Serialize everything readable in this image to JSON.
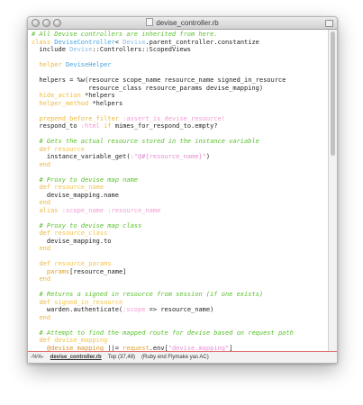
{
  "window": {
    "title": "devise_controller.rb"
  },
  "editor": {
    "lines": [
      [
        [
          "c",
          "# All Devise controllers are inherited from here."
        ]
      ],
      [
        [
          "k",
          "class "
        ],
        [
          "cl",
          "DeviseController"
        ],
        [
          "",
          "< "
        ],
        [
          "ce",
          "Devise"
        ],
        [
          "",
          ".parent_controller.constantize"
        ]
      ],
      [
        [
          "",
          "  include "
        ],
        [
          "ce",
          "Devise"
        ],
        [
          "",
          "::Controllers::ScopedViews"
        ]
      ],
      [
        [
          "",
          ""
        ]
      ],
      [
        [
          "",
          "  "
        ],
        [
          "k",
          "helper "
        ],
        [
          "cl",
          "DeviseHelper"
        ]
      ],
      [
        [
          "",
          ""
        ]
      ],
      [
        [
          "",
          "  helpers = %w(resource scope_name resource_name signed_in_resource"
        ]
      ],
      [
        [
          "",
          "               resource_class resource_params devise_mapping)"
        ]
      ],
      [
        [
          "",
          "  "
        ],
        [
          "k",
          "hide_action "
        ],
        [
          "",
          "*helpers"
        ]
      ],
      [
        [
          "",
          "  "
        ],
        [
          "k",
          "helper_method "
        ],
        [
          "",
          "*helpers"
        ]
      ],
      [
        [
          "",
          ""
        ]
      ],
      [
        [
          "",
          "  "
        ],
        [
          "k",
          "prepend_before_filter "
        ],
        [
          "sy",
          ":assert_is_devise_resource!"
        ]
      ],
      [
        [
          "",
          "  respond_to "
        ],
        [
          "sy",
          ":html "
        ],
        [
          "k",
          "if "
        ],
        [
          "",
          "mimes_for_respond_to.empty?"
        ]
      ],
      [
        [
          "",
          ""
        ]
      ],
      [
        [
          "",
          "  "
        ],
        [
          "c",
          "# Gets the actual resource stored in the instance variable"
        ]
      ],
      [
        [
          "",
          "  "
        ],
        [
          "k",
          "def "
        ],
        [
          "fn",
          "resource"
        ]
      ],
      [
        [
          "",
          "    instance_variable_get("
        ],
        [
          "s",
          ":\"@#{resource_name}\""
        ],
        [
          "",
          ")"
        ]
      ],
      [
        [
          "",
          "  "
        ],
        [
          "k",
          "end"
        ]
      ],
      [
        [
          "",
          ""
        ]
      ],
      [
        [
          "",
          "  "
        ],
        [
          "c",
          "# Proxy to devise map name"
        ]
      ],
      [
        [
          "",
          "  "
        ],
        [
          "k",
          "def "
        ],
        [
          "fn",
          "resource_name"
        ]
      ],
      [
        [
          "",
          "    devise_mapping.name"
        ]
      ],
      [
        [
          "",
          "  "
        ],
        [
          "k",
          "end"
        ]
      ],
      [
        [
          "",
          "  "
        ],
        [
          "k",
          "alias "
        ],
        [
          "sy",
          ":scope_name :resource_name"
        ]
      ],
      [
        [
          "",
          ""
        ]
      ],
      [
        [
          "",
          "  "
        ],
        [
          "c",
          "# Proxy to devise map class"
        ]
      ],
      [
        [
          "",
          "  "
        ],
        [
          "k",
          "def "
        ],
        [
          "fn",
          "resource_class"
        ]
      ],
      [
        [
          "",
          "    devise_mapping.to"
        ]
      ],
      [
        [
          "",
          "  "
        ],
        [
          "k",
          "end"
        ]
      ],
      [
        [
          "",
          ""
        ]
      ],
      [
        [
          "",
          "  "
        ],
        [
          "k",
          "def "
        ],
        [
          "fn",
          "resource_params"
        ]
      ],
      [
        [
          "",
          "    "
        ],
        [
          "m",
          "params"
        ],
        [
          "",
          "[resource_name]"
        ]
      ],
      [
        [
          "",
          "  "
        ],
        [
          "k",
          "end"
        ]
      ],
      [
        [
          "",
          ""
        ]
      ],
      [
        [
          "",
          "  "
        ],
        [
          "c",
          "# Returns a signed in resource from session (if one exists)"
        ]
      ],
      [
        [
          "",
          "  "
        ],
        [
          "k",
          "def "
        ],
        [
          "fn",
          "signed_in_resource"
        ]
      ],
      [
        [
          "",
          "    warden.authenticate("
        ],
        [
          "sy",
          ":scope "
        ],
        [
          "",
          "=> resource_name)"
        ]
      ],
      [
        [
          "",
          "  "
        ],
        [
          "k",
          "end"
        ]
      ],
      [
        [
          "",
          ""
        ]
      ],
      [
        [
          "",
          "  "
        ],
        [
          "c",
          "# Attempt to find the mapped route for devise based on request path"
        ]
      ],
      [
        [
          "",
          "  "
        ],
        [
          "k",
          "def "
        ],
        [
          "fn",
          "devise_mapping"
        ]
      ],
      [
        [
          "",
          "    "
        ],
        [
          "iv",
          "@devise_mapping "
        ],
        [
          "",
          "||= "
        ],
        [
          "m",
          "request"
        ],
        [
          "",
          ".env["
        ],
        [
          "s",
          "\"devise.mapping\""
        ],
        [
          "",
          "]"
        ]
      ],
      [
        [
          "",
          "  "
        ],
        [
          "k",
          "end"
        ]
      ],
      [
        [
          "",
          ""
        ]
      ]
    ]
  },
  "modeline": {
    "status": "-%%-",
    "buffer_name": "devise_controller.rb",
    "position": "Top (37,48)",
    "modes": "(Ruby end Flymake yas AC)"
  }
}
